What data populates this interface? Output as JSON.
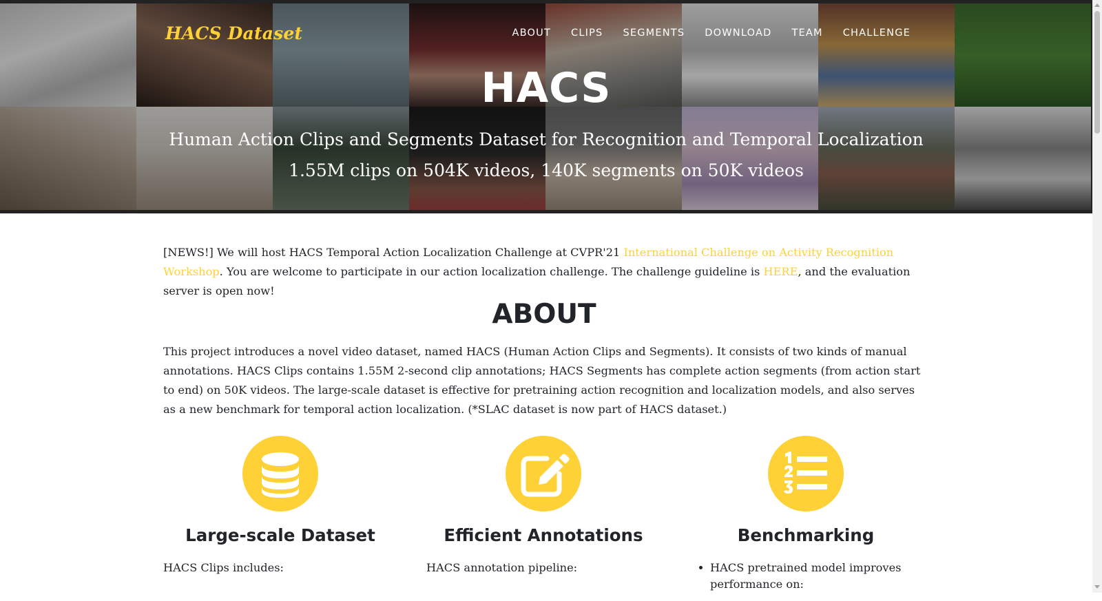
{
  "brand": "HACS Dataset",
  "nav": {
    "items": [
      "ABOUT",
      "CLIPS",
      "SEGMENTS",
      "DOWNLOAD",
      "TEAM",
      "CHALLENGE"
    ]
  },
  "hero": {
    "title": "HACS",
    "subtitle": "Human Action Clips and Segments Dataset for Recognition and Temporal Localization",
    "stats": "1.55M clips on 504K videos, 140K segments on 50K videos"
  },
  "news": {
    "prefix": "[NEWS!] We will host HACS Temporal Action Localization Challenge at CVPR'21 ",
    "workshop_link": "International Challenge on Activity Recognition Workshop",
    "middle": ". You are welcome to participate in our action localization challenge. The challenge guideline is ",
    "here_link": "HERE",
    "suffix": ", and the evaluation server is open now!"
  },
  "about": {
    "title": "ABOUT",
    "text": "This project introduces a novel video dataset, named HACS (Human Action Clips and Segments). It consists of two kinds of manual annotations. HACS Clips contains 1.55M 2-second clip annotations; HACS Segments has complete action segments (from action start to end) on 50K videos. The large-scale dataset is effective for pretraining action recognition and localization models, and also serves as a new benchmark for temporal action localization. (*SLAC dataset is now part of HACS dataset.)"
  },
  "features": [
    {
      "icon": "database-icon",
      "title": "Large-scale Dataset",
      "text": "HACS Clips includes:"
    },
    {
      "icon": "edit-icon",
      "title": "Efficient Annotations",
      "text": "HACS annotation pipeline:"
    },
    {
      "icon": "numbered-list-icon",
      "title": "Benchmarking",
      "list": [
        "HACS pretrained model improves performance on:"
      ]
    }
  ],
  "colors": {
    "accent": "#fed136",
    "text": "#212529",
    "hero_text": "#ffffff"
  }
}
